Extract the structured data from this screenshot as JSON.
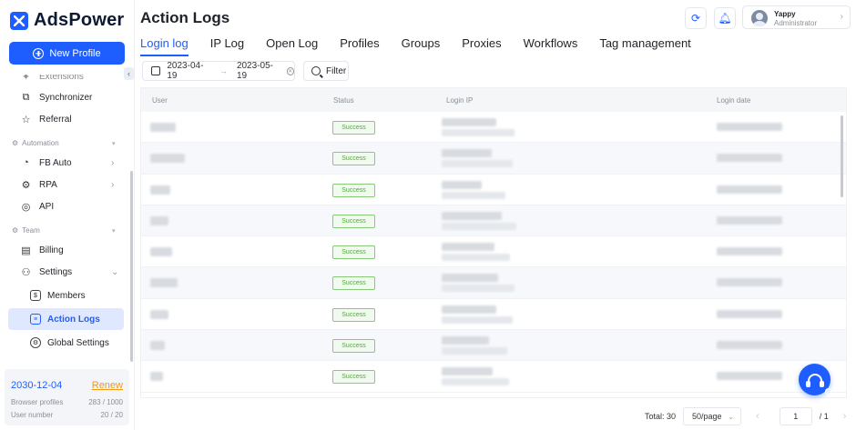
{
  "brand": {
    "name": "AdsPower",
    "color": "#1E5EFF"
  },
  "sidebar": {
    "new_profile": "New Profile",
    "items_top": [
      {
        "label": "Extensions",
        "icon": "puzzle-icon"
      },
      {
        "label": "Synchronizer",
        "icon": "sync-icon"
      },
      {
        "label": "Referral",
        "icon": "star-icon"
      }
    ],
    "automation": {
      "label": "Automation",
      "items": [
        {
          "label": "FB Auto",
          "icon": "fb-auto-icon"
        },
        {
          "label": "RPA",
          "icon": "rpa-icon"
        },
        {
          "label": "API",
          "icon": "api-icon"
        }
      ]
    },
    "team": {
      "label": "Team",
      "items": [
        {
          "label": "Billing",
          "icon": "billing-icon"
        },
        {
          "label": "Settings",
          "icon": "users-icon"
        }
      ]
    },
    "settings_sub": [
      {
        "label": "Members"
      },
      {
        "label": "Action Logs",
        "active": true
      },
      {
        "label": "Global Settings"
      }
    ],
    "account": {
      "expiry": "2030-12-04",
      "renew": "Renew",
      "profiles_label": "Browser profiles",
      "profiles_value": "283 / 1000",
      "users_label": "User number",
      "users_value": "20 / 20"
    }
  },
  "header": {
    "title": "Action Logs",
    "user": {
      "name": "Yappy",
      "role": "Administrator"
    }
  },
  "tabs": [
    "Login log",
    "IP Log",
    "Open Log",
    "Profiles",
    "Groups",
    "Proxies",
    "Workflows",
    "Tag management"
  ],
  "active_tab": "Login log",
  "filters": {
    "date_start": "2023-04-19",
    "date_end": "2023-05-19",
    "filter_label": "Filter"
  },
  "table": {
    "columns": [
      "User",
      "Status",
      "Login IP",
      "Login date"
    ],
    "rows": [
      {
        "status": "Success"
      },
      {
        "status": "Success"
      },
      {
        "status": "Success"
      },
      {
        "status": "Success"
      },
      {
        "status": "Success"
      },
      {
        "status": "Success"
      },
      {
        "status": "Success"
      },
      {
        "status": "Success"
      },
      {
        "status": "Success"
      }
    ]
  },
  "pagination": {
    "total": "Total: 30",
    "page_size": "50/page",
    "current": "1",
    "of": "/ 1"
  }
}
